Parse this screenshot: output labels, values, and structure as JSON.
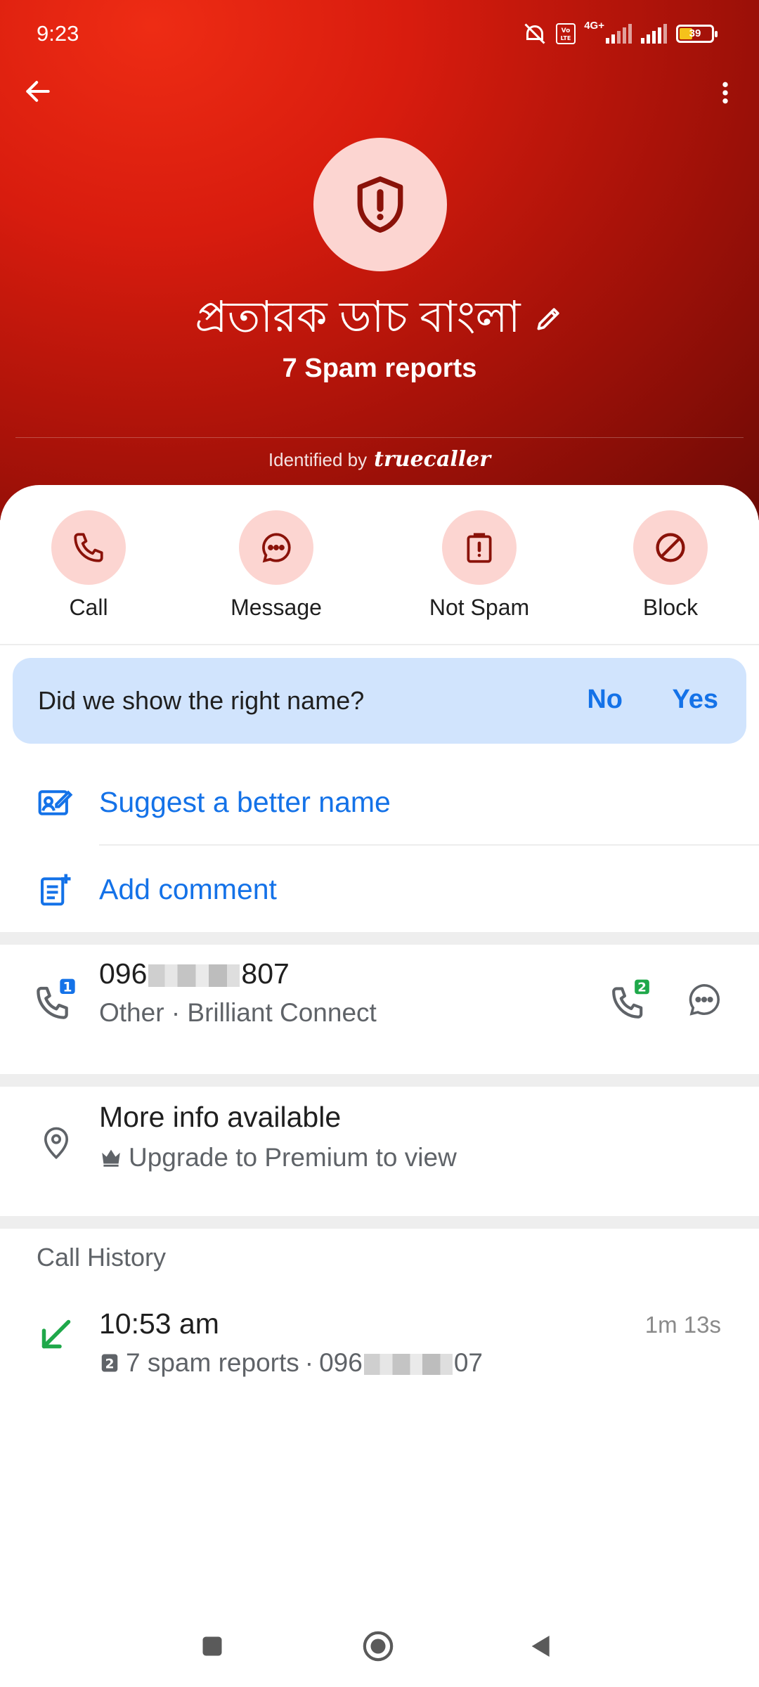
{
  "status_bar": {
    "time": "9:23",
    "battery": "39",
    "network": "4G+"
  },
  "header": {
    "contact_name": "প্রতারক ডাচ বাংলা",
    "spam_reports": "7 Spam reports",
    "identified_by": "Identified by",
    "brand": "truecaller",
    "accent_color": "#d81c0e"
  },
  "actions": [
    {
      "label": "Call",
      "icon": "phone-icon"
    },
    {
      "label": "Message",
      "icon": "chat-bubble-icon"
    },
    {
      "label": "Not Spam",
      "icon": "clipboard-alert-icon"
    },
    {
      "label": "Block",
      "icon": "block-icon"
    }
  ],
  "feedback": {
    "question": "Did we show the right name?",
    "no": "No",
    "yes": "Yes"
  },
  "links": {
    "suggest": "Suggest a better name",
    "comment": "Add comment"
  },
  "number": {
    "prefix": "096",
    "suffix": "807",
    "type": "Other · Brilliant Connect",
    "sim": "1",
    "call_sim": "2"
  },
  "more_info": {
    "title": "More info available",
    "subtitle": "Upgrade to Premium to view"
  },
  "call_history": {
    "title": "Call History",
    "entries": [
      {
        "time": "10:53 am",
        "spam_count": "7 spam reports",
        "separator": "·",
        "number_prefix": "096",
        "number_suffix": "07",
        "duration": "1m 13s",
        "sim": "2"
      }
    ]
  }
}
